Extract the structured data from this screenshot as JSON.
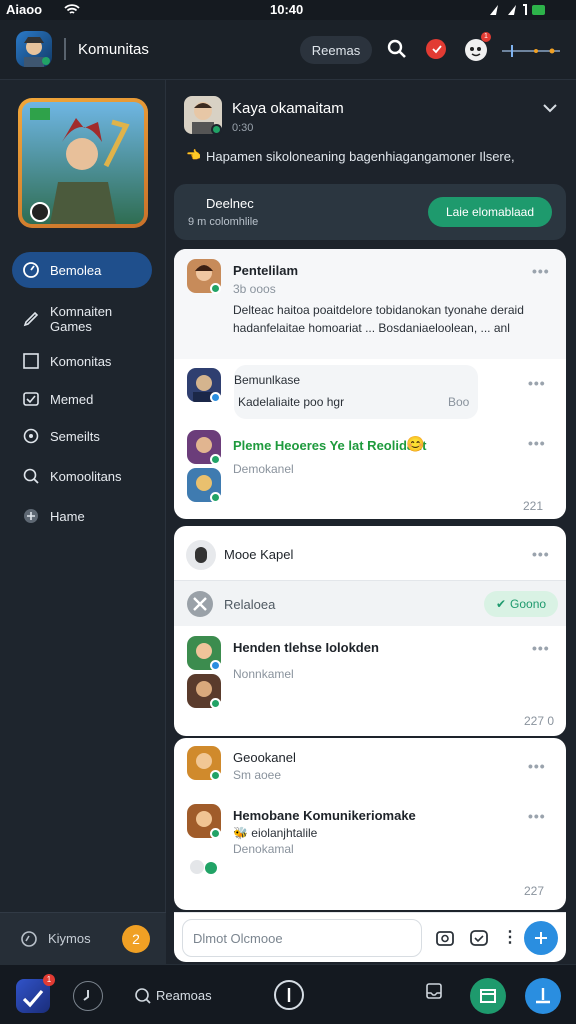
{
  "status_bar": {
    "left": "Aiaoo",
    "time": "10:40"
  },
  "header": {
    "app_title": "Komunitas",
    "rooms_label": "Reemas",
    "badge_count": "1"
  },
  "sidebar": {
    "items": [
      {
        "label": "Bemolea",
        "icon": "clock-icon"
      },
      {
        "label": "Komnaiten Games",
        "icon": "pen-icon"
      },
      {
        "label": "Komonitas",
        "icon": "square-icon"
      },
      {
        "label": "Memed",
        "icon": "check-icon"
      },
      {
        "label": "Semeilts",
        "icon": "settings-icon"
      },
      {
        "label": "Komoolitans",
        "icon": "search-icon"
      },
      {
        "label": "Hame",
        "icon": "game-icon"
      }
    ],
    "footer_label": "Kiymos",
    "footer_badge": "2"
  },
  "post": {
    "author": "Kaya okamaitam",
    "time": "0:30",
    "text": "Hapamen sikoloneaning bagenhiagangamoner Ilsere,",
    "banner_title": "Deelnec",
    "banner_sub": "9 m colomhlile",
    "banner_button": "Laie elomablaad"
  },
  "thread1": {
    "m1_name": "Pentelilam",
    "m1_time": "3b ooos",
    "m1_text": "Delteac haitoa poaitdelore tobidanokan tyonahe deraid hadanfelaitae homoariat ... Bosdaniaeloolean, ... anl",
    "m2_name": "Bemunlkase",
    "m2_text": "Kadelaliaite poo hgr",
    "m2_meta": "Boo",
    "m3_text": "Pleme Heoeres Ye lat Reolidant",
    "m3_sub": "Demokanel",
    "footer_meta": "221"
  },
  "thread2": {
    "title": "Mooe Kapel",
    "sub_title": "Relaloea",
    "sub_badge": "Goono",
    "m1_text": "Henden tlehse Iolokden",
    "m1_sub": "Nonnkamel",
    "footer_meta": "227 0"
  },
  "thread3": {
    "m1_name": "Geookanel",
    "m1_time": "Sm aoee",
    "m2_text": "Hemobane Komunikeriomake",
    "m2_line2": "eiolanjhtalile",
    "m2_sub": "Denokamal",
    "footer_meta": "227"
  },
  "composer": {
    "placeholder": "Dlmot Olcmooe"
  },
  "bottom_bar": {
    "label": "Reamoas",
    "badge": "1"
  },
  "colors": {
    "accent": "#1f4f8c",
    "green": "#1e9a6d",
    "blue": "#2a8ee0",
    "orange": "#f0a024"
  }
}
